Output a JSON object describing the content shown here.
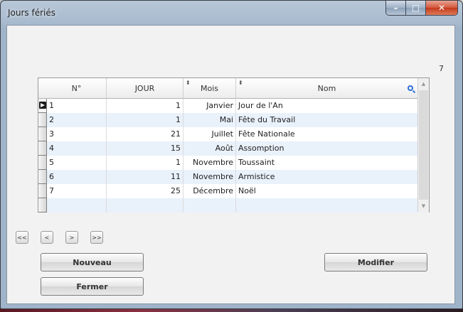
{
  "window": {
    "title": "Jours fériés",
    "controls": {
      "minimize": "–",
      "maximize": "□",
      "close": "✕"
    }
  },
  "record_count": "7",
  "table": {
    "columns": [
      {
        "label": "N°"
      },
      {
        "label": "JOUR"
      },
      {
        "label": "Mois",
        "sortable": true
      },
      {
        "label": "Nom",
        "sortable": true,
        "searchable": true
      }
    ],
    "rows": [
      {
        "no": "1",
        "jour": "1",
        "mois": "Janvier",
        "nom": "Jour de l'An"
      },
      {
        "no": "2",
        "jour": "1",
        "mois": "Mai",
        "nom": "Fête du Travail"
      },
      {
        "no": "3",
        "jour": "21",
        "mois": "Juillet",
        "nom": "Fête Nationale"
      },
      {
        "no": "4",
        "jour": "15",
        "mois": "Août",
        "nom": "Assomption"
      },
      {
        "no": "5",
        "jour": "1",
        "mois": "Novembre",
        "nom": "Toussaint"
      },
      {
        "no": "6",
        "jour": "11",
        "mois": "Novembre",
        "nom": "Armistice"
      },
      {
        "no": "7",
        "jour": "25",
        "mois": "Décembre",
        "nom": "Noël"
      }
    ],
    "current_row": 1
  },
  "navigation": {
    "first": "<<",
    "prev": "<",
    "next": ">",
    "last": ">>"
  },
  "buttons": {
    "nouveau": "Nouveau",
    "fermer": "Fermer",
    "modifier": "Modifier"
  },
  "icons": {
    "search": "search-icon",
    "current_row": "row-pointer-icon",
    "sort": "sort-icon"
  }
}
